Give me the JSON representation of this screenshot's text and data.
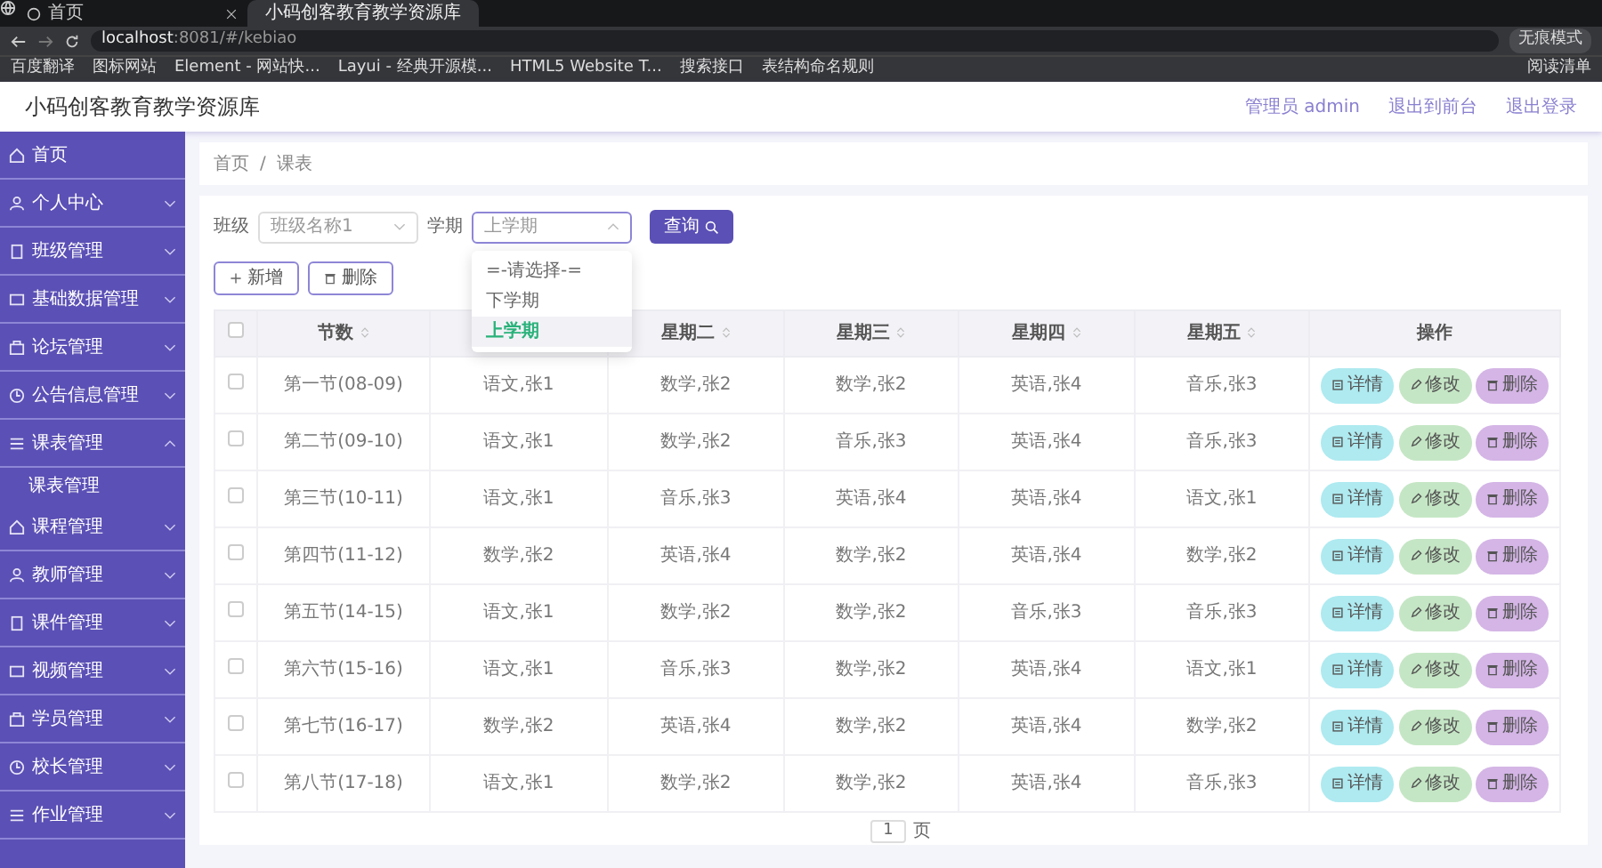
{
  "browser": {
    "tabs": [
      {
        "label": "首页",
        "selected": false
      },
      {
        "label": "小码创客教育教学资源库",
        "selected": true
      }
    ],
    "address": {
      "host": "localhost",
      "path": ":8081/#/kebiao"
    },
    "bookmarks": [
      "百度翻译",
      "图标网站",
      "Element - 网站快...",
      "Layui - 经典开源模...",
      "HTML5 Website T...",
      "搜索接口",
      "表结构命名规则"
    ],
    "profile": "无痕模式",
    "reading_list": "阅读清单"
  },
  "header": {
    "title": "小码创客教育教学资源库",
    "links": [
      "管理员 admin",
      "退出到前台",
      "退出登录"
    ]
  },
  "sidebar": {
    "items": [
      {
        "label": "首页"
      },
      {
        "label": "个人中心",
        "expanded": false
      },
      {
        "label": "班级管理",
        "expanded": false
      },
      {
        "label": "基础数据管理",
        "expanded": false
      },
      {
        "label": "论坛管理",
        "expanded": false
      },
      {
        "label": "公告信息管理",
        "expanded": false
      },
      {
        "label": "课表管理",
        "expanded": true,
        "children": [
          {
            "label": "课表管理"
          }
        ]
      },
      {
        "label": "课程管理",
        "expanded": false
      },
      {
        "label": "教师管理",
        "expanded": false
      },
      {
        "label": "课件管理",
        "expanded": false
      },
      {
        "label": "视频管理",
        "expanded": false
      },
      {
        "label": "学员管理",
        "expanded": false
      },
      {
        "label": "校长管理",
        "expanded": false
      },
      {
        "label": "作业管理",
        "expanded": false
      }
    ]
  },
  "breadcrumb": {
    "items": [
      "首页",
      "课表"
    ],
    "separator": "/"
  },
  "filters": [
    {
      "label": "班级",
      "value": "班级名称1",
      "open": false
    },
    {
      "label": "学期",
      "value": "上学期",
      "open": true,
      "options": [
        {
          "label": "=-请选择-=",
          "selected": false
        },
        {
          "label": "下学期",
          "selected": false
        },
        {
          "label": "上学期",
          "selected": true
        }
      ]
    }
  ],
  "search_button": "查询",
  "toolbar": [
    "新增",
    "删除"
  ],
  "table": {
    "all_checked": false,
    "columns": [
      {
        "label": "节数"
      },
      {},
      {
        "label": "星期二"
      },
      {
        "label": "星期三"
      },
      {
        "label": "星期四"
      },
      {
        "label": "星期五"
      }
    ],
    "action_column": "操作",
    "rows": [
      {
        "checked": false,
        "cells": [
          "第一节(08-09)",
          "语文,张1",
          "数学,张2",
          "数学,张2",
          "英语,张4",
          "音乐,张3"
        ],
        "actions": [
          {
            "label": "详情",
            "kind": "detail"
          },
          {
            "label": "修改",
            "kind": "edit"
          },
          {
            "label": "删除",
            "kind": "delete"
          }
        ]
      },
      {
        "checked": false,
        "cells": [
          "第二节(09-10)",
          "语文,张1",
          "数学,张2",
          "音乐,张3",
          "英语,张4",
          "音乐,张3"
        ],
        "actions": [
          {
            "label": "详情",
            "kind": "detail"
          },
          {
            "label": "修改",
            "kind": "edit"
          },
          {
            "label": "删除",
            "kind": "delete"
          }
        ]
      },
      {
        "checked": false,
        "cells": [
          "第三节(10-11)",
          "语文,张1",
          "音乐,张3",
          "英语,张4",
          "英语,张4",
          "语文,张1"
        ],
        "actions": [
          {
            "label": "详情",
            "kind": "detail"
          },
          {
            "label": "修改",
            "kind": "edit"
          },
          {
            "label": "删除",
            "kind": "delete"
          }
        ]
      },
      {
        "checked": false,
        "cells": [
          "第四节(11-12)",
          "数学,张2",
          "英语,张4",
          "数学,张2",
          "英语,张4",
          "数学,张2"
        ],
        "actions": [
          {
            "label": "详情",
            "kind": "detail"
          },
          {
            "label": "修改",
            "kind": "edit"
          },
          {
            "label": "删除",
            "kind": "delete"
          }
        ]
      },
      {
        "checked": false,
        "cells": [
          "第五节(14-15)",
          "语文,张1",
          "数学,张2",
          "数学,张2",
          "音乐,张3",
          "音乐,张3"
        ],
        "actions": [
          {
            "label": "详情",
            "kind": "detail"
          },
          {
            "label": "修改",
            "kind": "edit"
          },
          {
            "label": "删除",
            "kind": "delete"
          }
        ]
      },
      {
        "checked": false,
        "cells": [
          "第六节(15-16)",
          "语文,张1",
          "音乐,张3",
          "数学,张2",
          "英语,张4",
          "语文,张1"
        ],
        "actions": [
          {
            "label": "详情",
            "kind": "detail"
          },
          {
            "label": "修改",
            "kind": "edit"
          },
          {
            "label": "删除",
            "kind": "delete"
          }
        ]
      },
      {
        "checked": false,
        "cells": [
          "第七节(16-17)",
          "数学,张2",
          "英语,张4",
          "数学,张2",
          "英语,张4",
          "数学,张2"
        ],
        "actions": [
          {
            "label": "详情",
            "kind": "detail"
          },
          {
            "label": "修改",
            "kind": "edit"
          },
          {
            "label": "删除",
            "kind": "delete"
          }
        ]
      },
      {
        "checked": false,
        "cells": [
          "第八节(17-18)",
          "语文,张1",
          "数学,张2",
          "数学,张2",
          "英语,张4",
          "音乐,张3"
        ],
        "actions": [
          {
            "label": "详情",
            "kind": "detail"
          },
          {
            "label": "修改",
            "kind": "edit"
          },
          {
            "label": "删除",
            "kind": "delete"
          }
        ]
      }
    ]
  },
  "pagination": {
    "page": "1",
    "unit": "页"
  }
}
